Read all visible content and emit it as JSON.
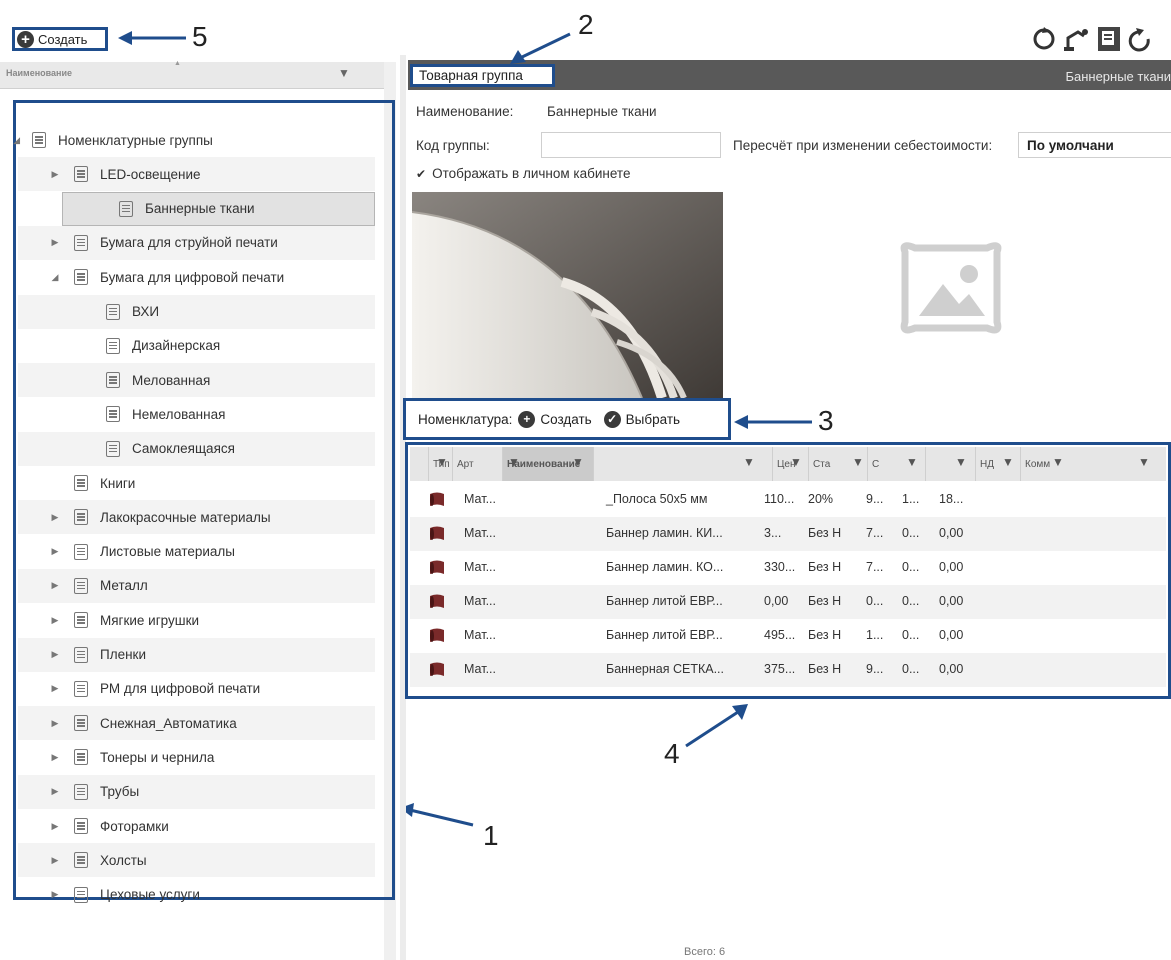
{
  "toolbar": {
    "create_label": "Создать"
  },
  "callouts": [
    "1",
    "2",
    "3",
    "4",
    "5"
  ],
  "left_panel": {
    "column_header": "Наименование",
    "tree": [
      {
        "label": "Номенклатурные группы",
        "level": 0,
        "expander": "expanded"
      },
      {
        "label": "LED-освещение",
        "level": 1,
        "expander": "collapsed"
      },
      {
        "label": "Баннерные ткани",
        "level": 1,
        "expander": "none",
        "selected": true
      },
      {
        "label": "Бумага для струйной печати",
        "level": 1,
        "expander": "collapsed"
      },
      {
        "label": "Бумага для цифровой печати",
        "level": 1,
        "expander": "expanded"
      },
      {
        "label": "ВХИ",
        "level": 2,
        "expander": "none"
      },
      {
        "label": "Дизайнерская",
        "level": 2,
        "expander": "none"
      },
      {
        "label": "Мелованная",
        "level": 2,
        "expander": "none"
      },
      {
        "label": "Немелованная",
        "level": 2,
        "expander": "none"
      },
      {
        "label": "Самоклеящаяся",
        "level": 2,
        "expander": "none"
      },
      {
        "label": "Книги",
        "level": 1,
        "expander": "none"
      },
      {
        "label": "Лакокрасочные материалы",
        "level": 1,
        "expander": "collapsed"
      },
      {
        "label": "Листовые материалы",
        "level": 1,
        "expander": "collapsed"
      },
      {
        "label": "Металл",
        "level": 1,
        "expander": "collapsed"
      },
      {
        "label": "Мягкие игрушки",
        "level": 1,
        "expander": "collapsed"
      },
      {
        "label": "Пленки",
        "level": 1,
        "expander": "collapsed"
      },
      {
        "label": "РМ для цифровой печати",
        "level": 1,
        "expander": "collapsed"
      },
      {
        "label": "Снежная_Автоматика",
        "level": 1,
        "expander": "collapsed"
      },
      {
        "label": "Тонеры и чернила",
        "level": 1,
        "expander": "collapsed"
      },
      {
        "label": "Трубы",
        "level": 1,
        "expander": "collapsed"
      },
      {
        "label": "Фоторамки",
        "level": 1,
        "expander": "collapsed"
      },
      {
        "label": "Холсты",
        "level": 1,
        "expander": "collapsed"
      },
      {
        "label": "Цеховые услуги",
        "level": 1,
        "expander": "collapsed"
      }
    ]
  },
  "group": {
    "tab_label": "Товарная группа",
    "header_right": "Баннерные ткани",
    "name_label": "Наименование:",
    "name_value": "Баннерные ткани",
    "code_label": "Код группы:",
    "code_value": "",
    "recalc_label": "Пересчёт при изменении себестоимости:",
    "recalc_value": "По умолчани",
    "show_in_cabinet": "Отображать в личном кабинете"
  },
  "nomenclature": {
    "label": "Номенклатура:",
    "create_label": "Создать",
    "select_label": "Выбрать"
  },
  "grid": {
    "columns": [
      "Тип",
      "Арт",
      "Наименование",
      "",
      "Цен",
      "Ста",
      "С",
      "",
      "НД",
      "Комм"
    ],
    "rows": [
      [
        "Мат...",
        "",
        "_Полоса 50х5 мм",
        "",
        "110...",
        "20%",
        "9...",
        "1...",
        "18..."
      ],
      [
        "Мат...",
        "",
        "Баннер ламин. КИ...",
        "",
        "3...",
        "Без Н",
        "7...",
        "0...",
        "0,00"
      ],
      [
        "Мат...",
        "",
        "Баннер ламин. КО...",
        "",
        "330...",
        "Без Н",
        "7...",
        "0...",
        "0,00"
      ],
      [
        "Мат...",
        "",
        "Баннер литой ЕВР...",
        "",
        "0,00",
        "Без Н",
        "0...",
        "0...",
        "0,00"
      ],
      [
        "Мат...",
        "",
        "Баннер литой ЕВР...",
        "",
        "495...",
        "Без Н",
        "1...",
        "0...",
        "0,00"
      ],
      [
        "Мат...",
        "",
        "Баннерная СЕТКА...",
        "",
        "375...",
        "Без Н",
        "9...",
        "0...",
        "0,00"
      ]
    ],
    "total": "Всего: 6"
  },
  "colors": {
    "callout_blue": "#1f4d8c",
    "header_dark": "#595959",
    "material_icon": "#7a2a2a"
  }
}
